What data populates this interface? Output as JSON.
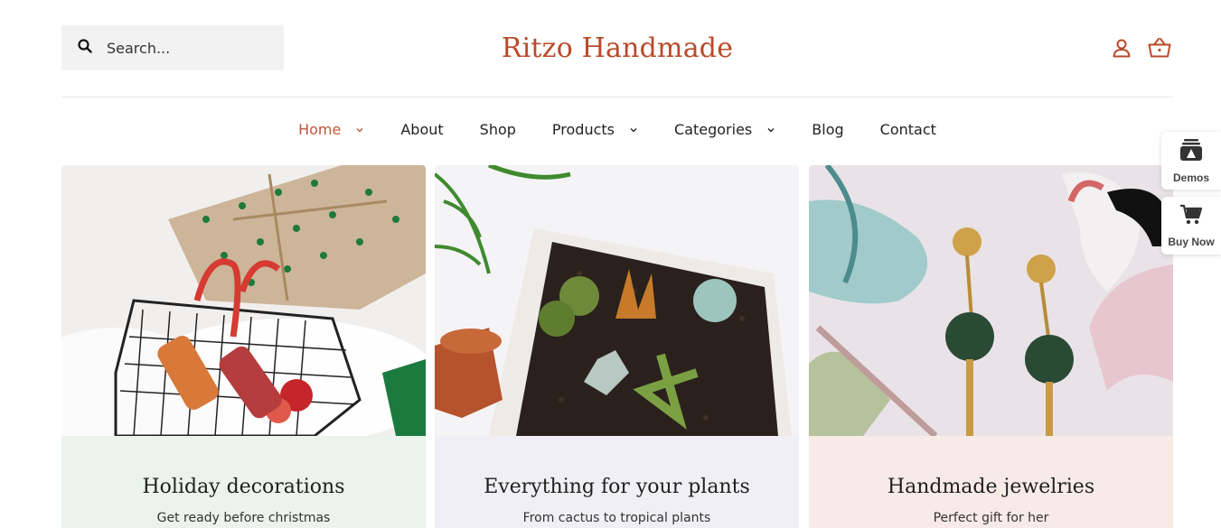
{
  "search": {
    "placeholder": "Search..."
  },
  "brand": {
    "name": "Ritzo Handmade",
    "accent": "#b84a2a"
  },
  "header_icons": [
    "user-icon",
    "basket-icon"
  ],
  "nav": {
    "items": [
      {
        "label": "Home",
        "active": true,
        "dropdown": true
      },
      {
        "label": "About",
        "active": false,
        "dropdown": false
      },
      {
        "label": "Shop",
        "active": false,
        "dropdown": false
      },
      {
        "label": "Products",
        "active": false,
        "dropdown": true
      },
      {
        "label": "Categories",
        "active": false,
        "dropdown": true
      },
      {
        "label": "Blog",
        "active": false,
        "dropdown": false
      },
      {
        "label": "Contact",
        "active": false,
        "dropdown": false
      }
    ]
  },
  "cards": [
    {
      "title": "Holiday decorations",
      "subtitle": "Get ready before christmas",
      "caption_bg": "#eaf4ec"
    },
    {
      "title": "Everything for your plants",
      "subtitle": "From cactus to tropical plants",
      "caption_bg": "#f0eff6"
    },
    {
      "title": "Handmade jewelries",
      "subtitle": "Perfect gift for her",
      "caption_bg": "#f8ebe7"
    }
  ],
  "side_widgets": {
    "demos": {
      "label": "Demos"
    },
    "buy_now": {
      "label": "Buy Now"
    }
  }
}
